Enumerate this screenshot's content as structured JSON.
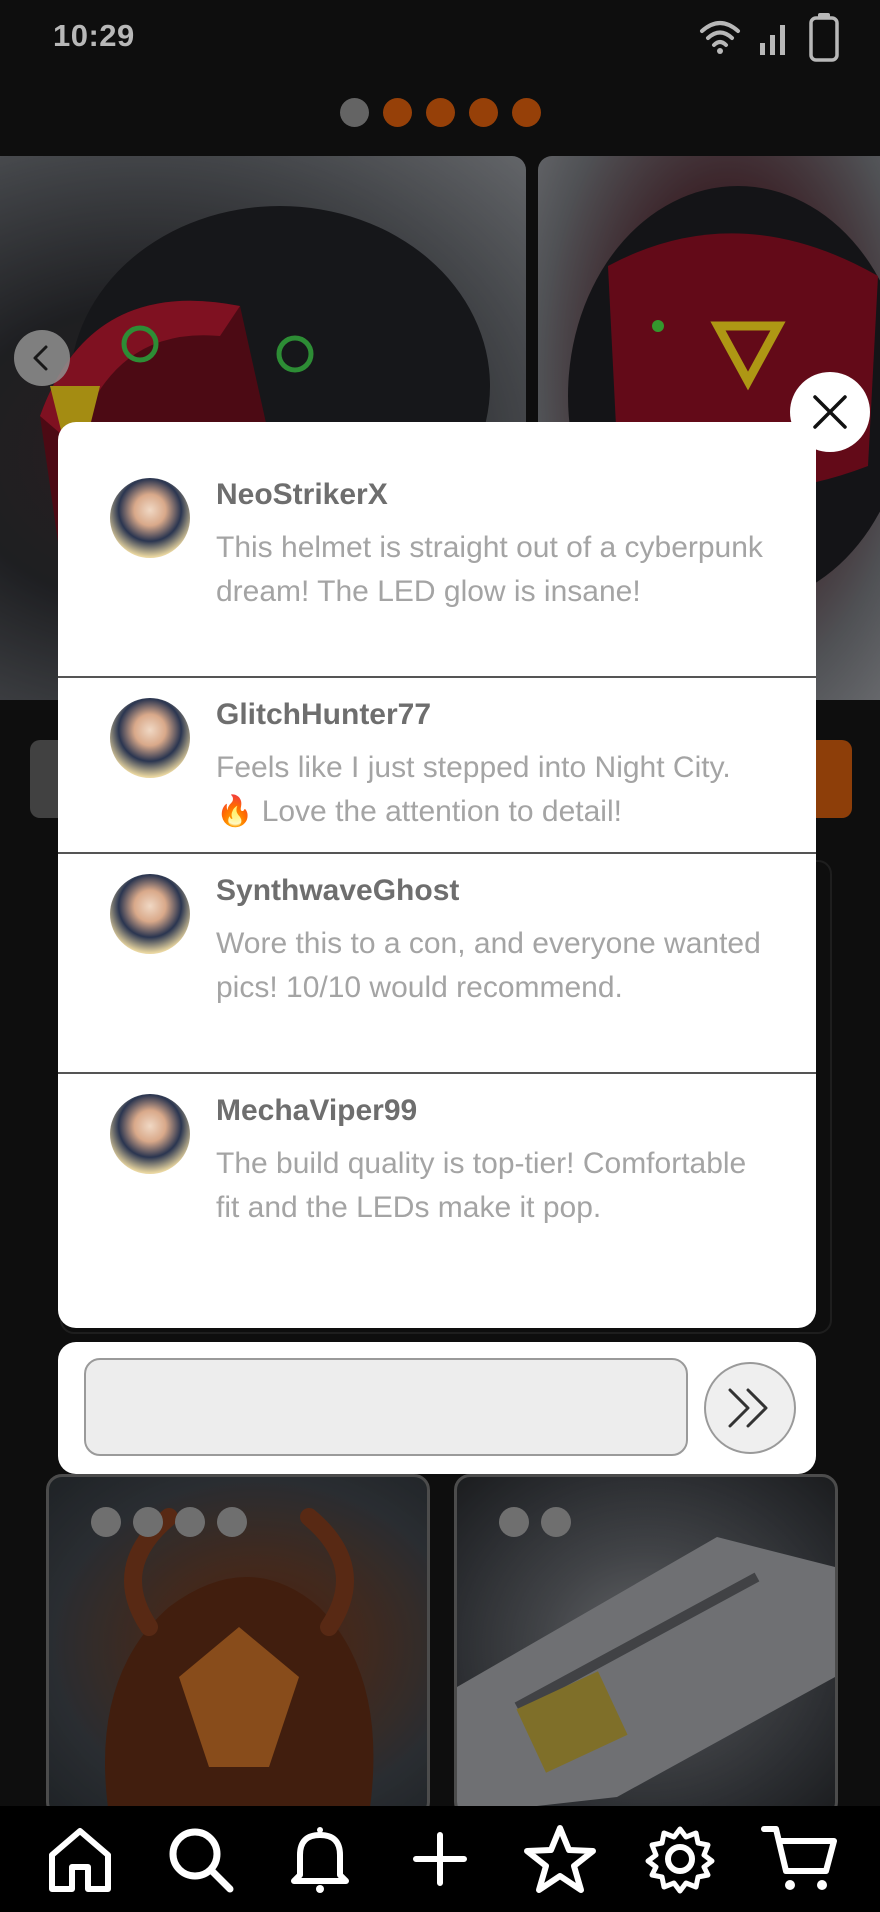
{
  "status_bar": {
    "time": "10:29"
  },
  "carousel": {
    "dot_count": 5,
    "active_index": 0
  },
  "comments": [
    {
      "user": "NeoStrikerX",
      "text": "This helmet is straight out of a cyberpunk dream! The LED glow is insane!"
    },
    {
      "user": "GlitchHunter77",
      "text": "Feels like I just stepped into Night City. 🔥 Love the attention to detail!"
    },
    {
      "user": "SynthwaveGhost",
      "text": "Wore this to a con, and everyone wanted pics! 10/10 would recommend."
    },
    {
      "user": "MechaViper99",
      "text": "The build quality is top-tier! Comfortable fit and the LEDs make it pop."
    }
  ],
  "composer": {
    "placeholder": "",
    "value": ""
  },
  "tab_bar": {
    "items": [
      "home-icon",
      "search-icon",
      "bell-icon",
      "plus-icon",
      "star-icon",
      "gear-icon",
      "cart-icon"
    ]
  },
  "colors": {
    "accent": "#d0590c",
    "background": "#141414"
  }
}
